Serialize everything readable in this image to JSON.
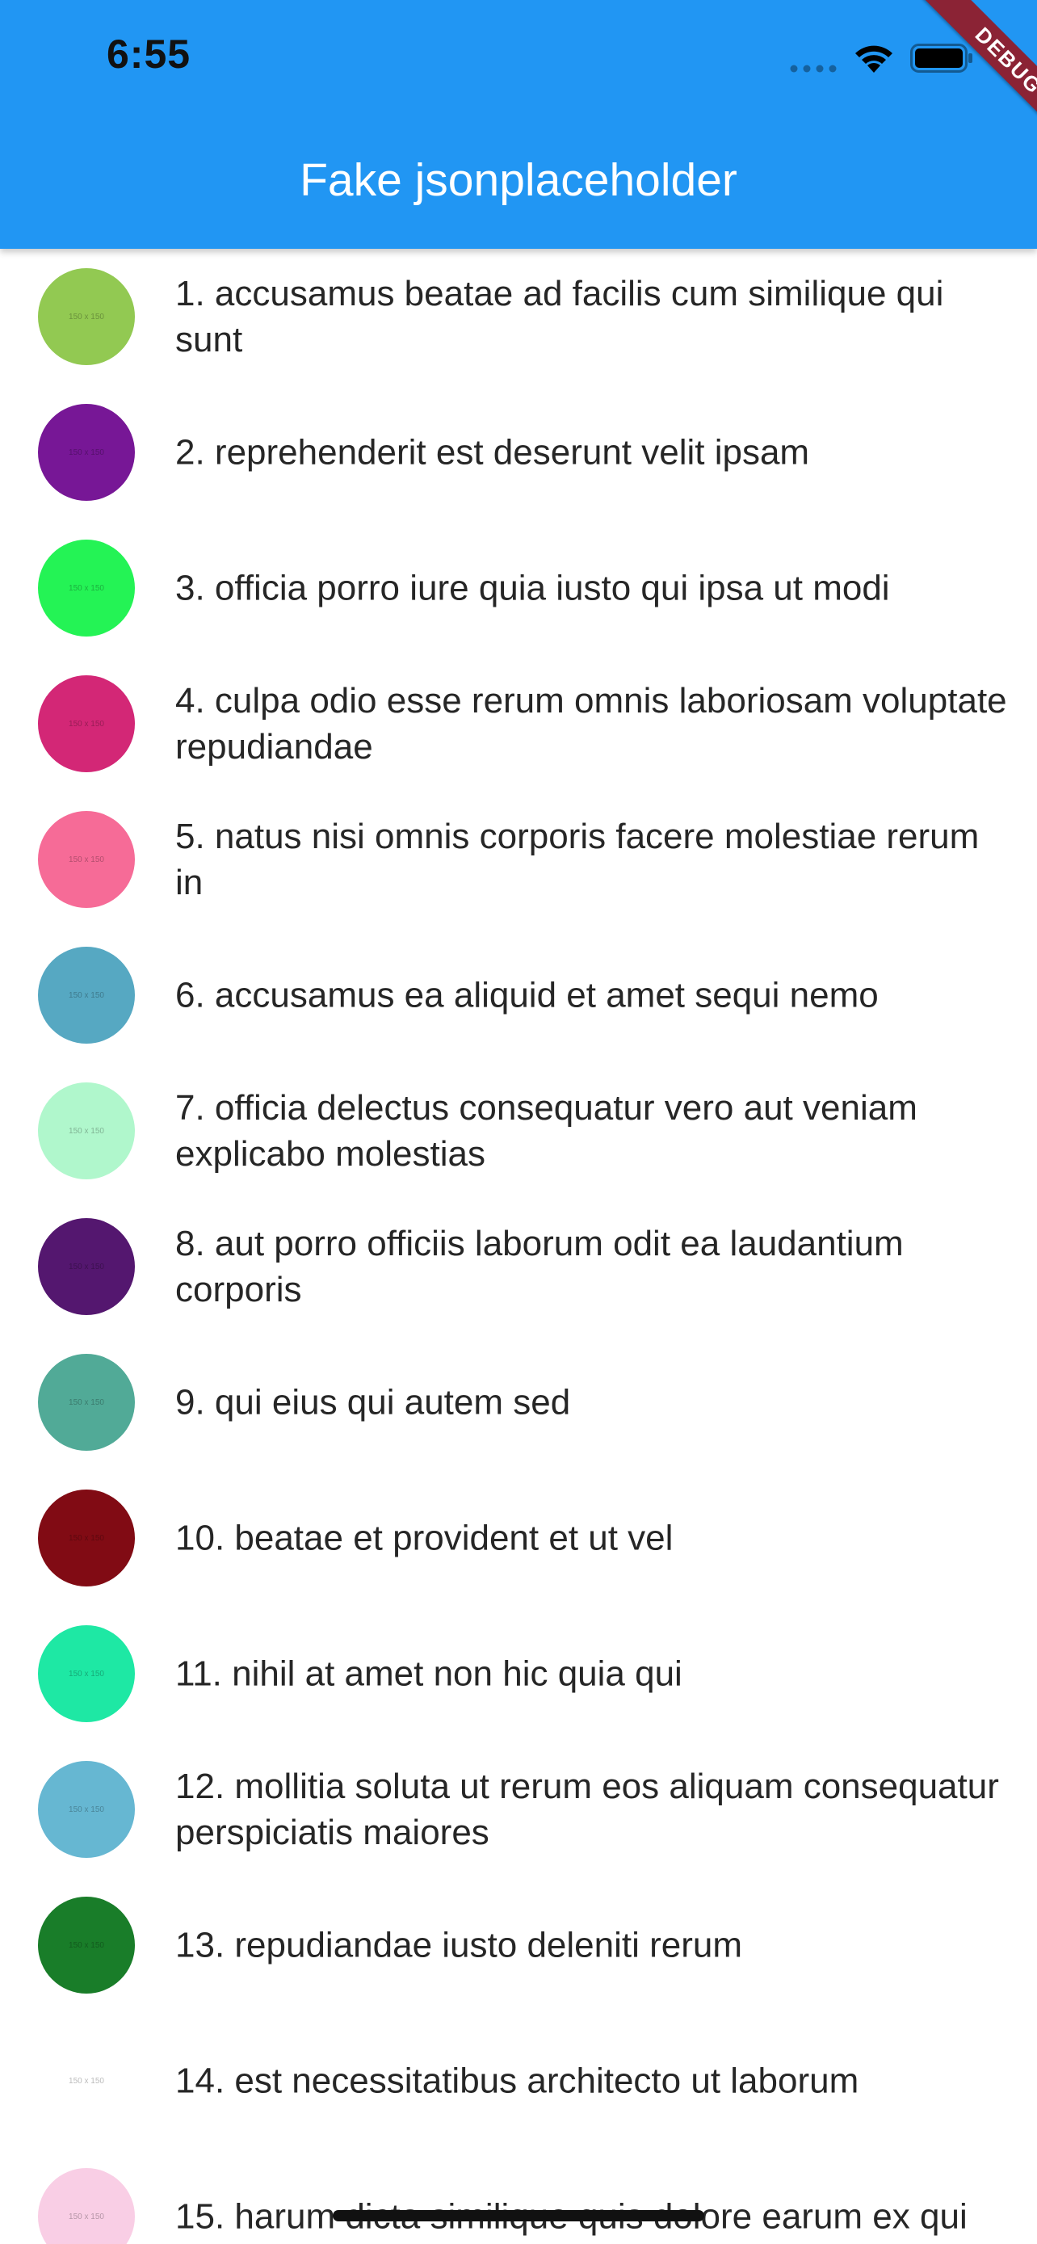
{
  "status_bar": {
    "time": "6:55",
    "icons": [
      "signal-icon",
      "wifi-icon",
      "battery-icon"
    ]
  },
  "app_bar": {
    "title": "Fake jsonplaceholder",
    "color": "#2196f3"
  },
  "debug_banner": {
    "label": "DEBUG",
    "color": "#8b2335"
  },
  "photos": [
    {
      "title": "1. accusamus beatae ad facilis cum similique qui sunt",
      "thumb_color": "#92c952",
      "thumb_text": "150 x 150"
    },
    {
      "title": "2. reprehenderit est deserunt velit ipsam",
      "thumb_color": "#771796",
      "thumb_text": "150 x 150"
    },
    {
      "title": "3. officia porro iure quia iusto qui ipsa ut modi",
      "thumb_color": "#24f355",
      "thumb_text": "150 x 150"
    },
    {
      "title": "4. culpa odio esse rerum omnis laboriosam voluptate repudiandae",
      "thumb_color": "#d32776",
      "thumb_text": "150 x 150"
    },
    {
      "title": "5. natus nisi omnis corporis facere molestiae rerum in",
      "thumb_color": "#f66b97",
      "thumb_text": "150 x 150"
    },
    {
      "title": "6. accusamus ea aliquid et amet sequi nemo",
      "thumb_color": "#56a8c2",
      "thumb_text": "150 x 150"
    },
    {
      "title": "7. officia delectus consequatur vero aut veniam explicabo molestias",
      "thumb_color": "#b0f7cc",
      "thumb_text": "150 x 150"
    },
    {
      "title": "8. aut porro officiis laborum odit ea laudantium corporis",
      "thumb_color": "#54176f",
      "thumb_text": "150 x 150"
    },
    {
      "title": "9. qui eius qui autem sed",
      "thumb_color": "#51aa97",
      "thumb_text": "150 x 150"
    },
    {
      "title": "10. beatae et provident et ut vel",
      "thumb_color": "#810b14",
      "thumb_text": "150 x 150"
    },
    {
      "title": "11. nihil at amet non hic quia qui",
      "thumb_color": "#1ee8a4",
      "thumb_text": "150 x 150"
    },
    {
      "title": "12. mollitia soluta ut rerum eos aliquam consequatur perspiciatis maiores",
      "thumb_color": "#66b7d2",
      "thumb_text": "150 x 150"
    },
    {
      "title": "13. repudiandae iusto deleniti rerum",
      "thumb_color": "#197d29",
      "thumb_text": "150 x 150"
    },
    {
      "title": "14. est necessitatibus architecto ut laborum",
      "thumb_color": "#61a65",
      "thumb_text": "150 x 150"
    },
    {
      "title": "15. harum dicta similique quis dolore earum ex qui",
      "thumb_color": "#f9cee5",
      "thumb_text": "150 x 150"
    }
  ]
}
